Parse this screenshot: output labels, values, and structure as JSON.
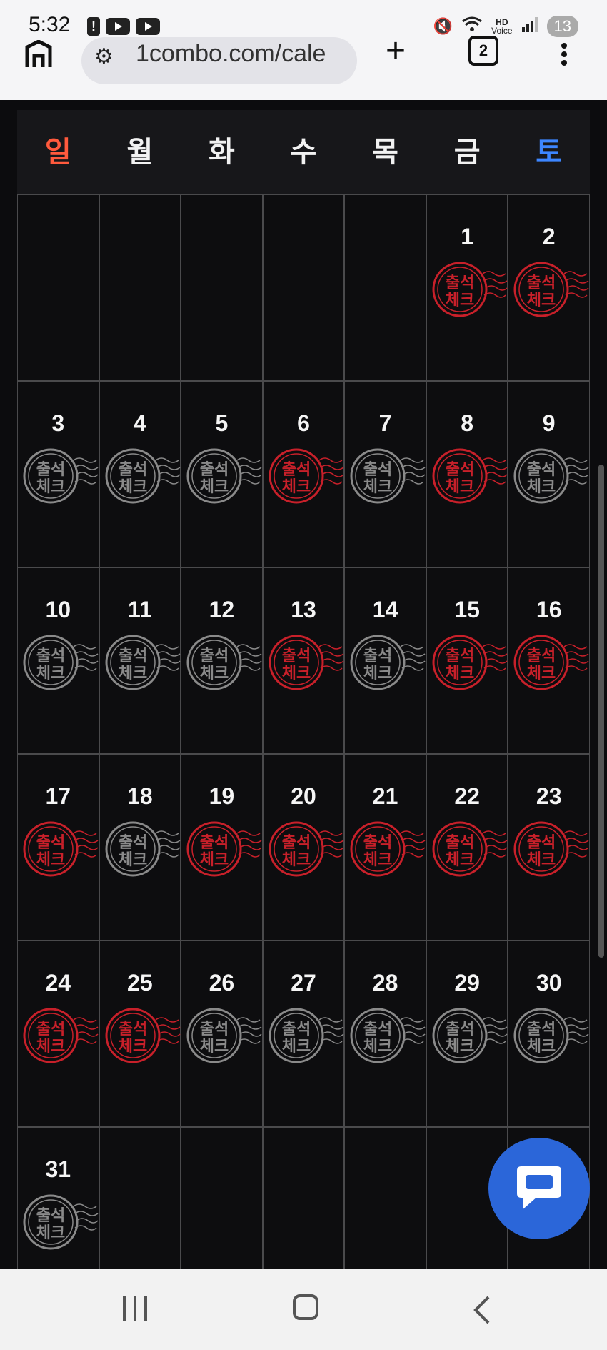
{
  "status_bar": {
    "time": "5:32",
    "battery": "13",
    "hd_label": "HD",
    "voice_label": "Voice"
  },
  "browser": {
    "url": "1combo.com/cale",
    "tab_count": "2"
  },
  "calendar": {
    "weekdays": [
      "일",
      "월",
      "화",
      "수",
      "목",
      "금",
      "토"
    ],
    "weekday_colors": [
      "#ff5a3d",
      "#f2f2f2",
      "#f2f2f2",
      "#f2f2f2",
      "#f2f2f2",
      "#f2f2f2",
      "#3d86ff"
    ],
    "stamp_text_top": "출석",
    "stamp_text_bottom": "체크",
    "stamp_colors": {
      "red": "#c8202a",
      "gray": "#8a8a8a"
    },
    "days": [
      {
        "day": "",
        "stamp": ""
      },
      {
        "day": "",
        "stamp": ""
      },
      {
        "day": "",
        "stamp": ""
      },
      {
        "day": "",
        "stamp": ""
      },
      {
        "day": "",
        "stamp": ""
      },
      {
        "day": "1",
        "stamp": "red"
      },
      {
        "day": "2",
        "stamp": "red"
      },
      {
        "day": "3",
        "stamp": "gray"
      },
      {
        "day": "4",
        "stamp": "gray"
      },
      {
        "day": "5",
        "stamp": "gray"
      },
      {
        "day": "6",
        "stamp": "red"
      },
      {
        "day": "7",
        "stamp": "gray"
      },
      {
        "day": "8",
        "stamp": "red"
      },
      {
        "day": "9",
        "stamp": "gray"
      },
      {
        "day": "10",
        "stamp": "gray"
      },
      {
        "day": "11",
        "stamp": "gray"
      },
      {
        "day": "12",
        "stamp": "gray"
      },
      {
        "day": "13",
        "stamp": "red"
      },
      {
        "day": "14",
        "stamp": "gray"
      },
      {
        "day": "15",
        "stamp": "red"
      },
      {
        "day": "16",
        "stamp": "red"
      },
      {
        "day": "17",
        "stamp": "red"
      },
      {
        "day": "18",
        "stamp": "gray"
      },
      {
        "day": "19",
        "stamp": "red"
      },
      {
        "day": "20",
        "stamp": "red"
      },
      {
        "day": "21",
        "stamp": "red"
      },
      {
        "day": "22",
        "stamp": "red"
      },
      {
        "day": "23",
        "stamp": "red"
      },
      {
        "day": "24",
        "stamp": "red"
      },
      {
        "day": "25",
        "stamp": "red"
      },
      {
        "day": "26",
        "stamp": "gray"
      },
      {
        "day": "27",
        "stamp": "gray"
      },
      {
        "day": "28",
        "stamp": "gray"
      },
      {
        "day": "29",
        "stamp": "gray"
      },
      {
        "day": "30",
        "stamp": "gray"
      },
      {
        "day": "31",
        "stamp": "gray"
      },
      {
        "day": "",
        "stamp": ""
      },
      {
        "day": "",
        "stamp": ""
      },
      {
        "day": "",
        "stamp": ""
      },
      {
        "day": "",
        "stamp": ""
      },
      {
        "day": "",
        "stamp": ""
      },
      {
        "day": "",
        "stamp": ""
      }
    ]
  },
  "icons": {
    "home": "home-icon",
    "site_info": "site-settings-icon",
    "new_tab": "plus-icon",
    "tabs": "tab-switcher-icon",
    "menu": "more-vert-icon",
    "chat": "chat-bubble-icon",
    "nav_recent": "recent-apps-icon",
    "nav_home": "home-nav-icon",
    "nav_back": "back-icon"
  }
}
